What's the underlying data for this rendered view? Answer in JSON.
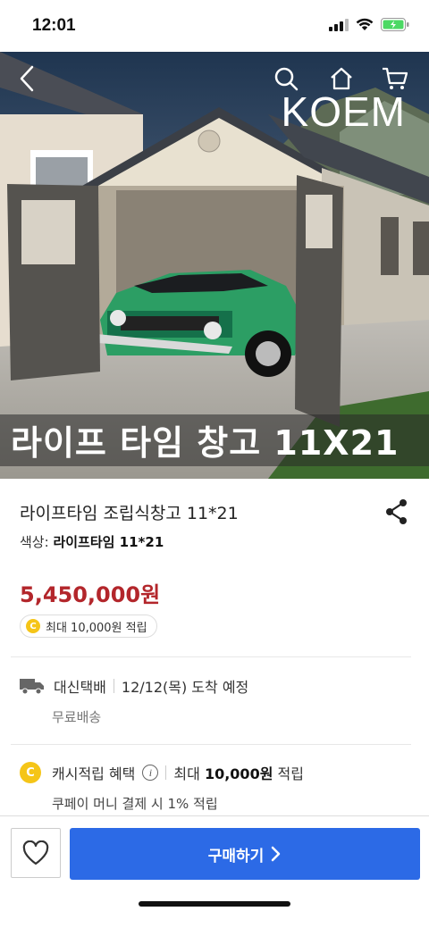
{
  "status_bar": {
    "time": "12:01"
  },
  "hero": {
    "caption": "라이프 타임 창고 11X21",
    "brand_logo": "KOEM"
  },
  "nav": {
    "back_icon": "back-arrow-icon",
    "search_icon": "search-icon",
    "home_icon": "home-icon",
    "cart_icon": "cart-icon"
  },
  "product": {
    "title": "라이프타임 조립식창고 11*21",
    "option_label": "색상:",
    "option_value": "라이프타임 11*21",
    "price": "5,450,000원",
    "reward_coin": "C",
    "reward_text": "최대 10,000원 적립"
  },
  "shipping": {
    "carrier": "대신택배",
    "arrival": "12/12(목) 도착 예정",
    "fee": "무료배송"
  },
  "cashback": {
    "coin": "C",
    "label": "캐시적립 혜택",
    "info": "i",
    "max_prefix": "최대",
    "max_amount": "10,000원",
    "max_suffix": "적립",
    "kpay_note": "쿠페이 머니 결제 시 1% 적립"
  },
  "bottom_bar": {
    "buy_label": "구매하기"
  },
  "colors": {
    "price": "#b3262b",
    "buy_button": "#2c6ae6",
    "coin": "#f5c518"
  }
}
